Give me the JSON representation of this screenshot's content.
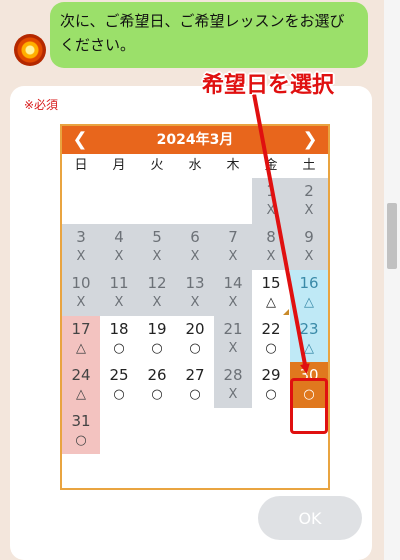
{
  "message": {
    "text": "次に、ご希望日、ご希望レッスンをお選びください。"
  },
  "form": {
    "required_label": "※必須"
  },
  "calendar": {
    "title": "2024年3月",
    "prev_icon": "chevron-left-icon",
    "next_icon": "chevron-right-icon",
    "weekdays": [
      "日",
      "月",
      "火",
      "水",
      "木",
      "金",
      "土"
    ],
    "days": [
      {
        "day": "",
        "mark": "",
        "state": "empty"
      },
      {
        "day": "",
        "mark": "",
        "state": "empty"
      },
      {
        "day": "",
        "mark": "",
        "state": "empty"
      },
      {
        "day": "",
        "mark": "",
        "state": "empty"
      },
      {
        "day": "",
        "mark": "",
        "state": "empty"
      },
      {
        "day": "1",
        "mark": "X",
        "state": "gray"
      },
      {
        "day": "2",
        "mark": "X",
        "state": "gray"
      },
      {
        "day": "3",
        "mark": "X",
        "state": "gray"
      },
      {
        "day": "4",
        "mark": "X",
        "state": "gray"
      },
      {
        "day": "5",
        "mark": "X",
        "state": "gray"
      },
      {
        "day": "6",
        "mark": "X",
        "state": "gray"
      },
      {
        "day": "7",
        "mark": "X",
        "state": "gray"
      },
      {
        "day": "8",
        "mark": "X",
        "state": "gray"
      },
      {
        "day": "9",
        "mark": "X",
        "state": "gray"
      },
      {
        "day": "10",
        "mark": "X",
        "state": "gray"
      },
      {
        "day": "11",
        "mark": "X",
        "state": "gray"
      },
      {
        "day": "12",
        "mark": "X",
        "state": "gray"
      },
      {
        "day": "13",
        "mark": "X",
        "state": "gray"
      },
      {
        "day": "14",
        "mark": "X",
        "state": "gray"
      },
      {
        "day": "15",
        "mark": "△",
        "state": "white"
      },
      {
        "day": "16",
        "mark": "△",
        "state": "cyan"
      },
      {
        "day": "17",
        "mark": "△",
        "state": "pink"
      },
      {
        "day": "18",
        "mark": "○",
        "state": "white"
      },
      {
        "day": "19",
        "mark": "○",
        "state": "white"
      },
      {
        "day": "20",
        "mark": "○",
        "state": "white"
      },
      {
        "day": "21",
        "mark": "X",
        "state": "gray"
      },
      {
        "day": "22",
        "mark": "○",
        "state": "white"
      },
      {
        "day": "23",
        "mark": "△",
        "state": "cyan"
      },
      {
        "day": "24",
        "mark": "△",
        "state": "pink"
      },
      {
        "day": "25",
        "mark": "○",
        "state": "white"
      },
      {
        "day": "26",
        "mark": "○",
        "state": "white"
      },
      {
        "day": "27",
        "mark": "○",
        "state": "white"
      },
      {
        "day": "28",
        "mark": "X",
        "state": "gray"
      },
      {
        "day": "29",
        "mark": "○",
        "state": "white"
      },
      {
        "day": "30",
        "mark": "○",
        "state": "selected"
      },
      {
        "day": "31",
        "mark": "○",
        "state": "pink"
      }
    ]
  },
  "annotation": {
    "text": "希望日を選択",
    "color": "#e01010"
  },
  "buttons": {
    "ok_label": "OK"
  },
  "colors": {
    "bubble": "#9be06a",
    "header": "#e8661c",
    "selected": "#e0781e"
  }
}
